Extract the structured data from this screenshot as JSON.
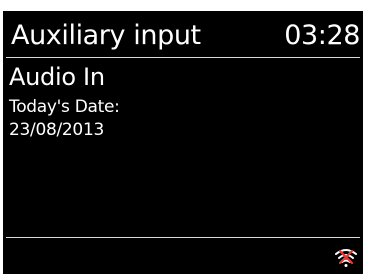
{
  "header": {
    "title": "Auxiliary input",
    "clock": "03:28"
  },
  "main": {
    "mode_label": "Audio In",
    "date_label": "Today's Date:",
    "date_value": "23/08/2013"
  },
  "status_bar": {
    "wifi_icon": "wifi-disconnected-icon",
    "wifi_cross_color": "#e53935"
  }
}
